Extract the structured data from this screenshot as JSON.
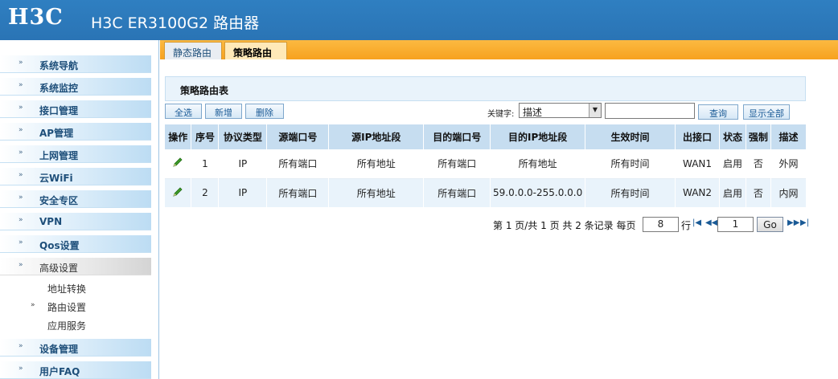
{
  "header": {
    "logo": "H3C",
    "product": "H3C ER3100G2 路由器"
  },
  "sidebar": {
    "items": [
      {
        "label": "系统导航"
      },
      {
        "label": "系统监控"
      },
      {
        "label": "接口管理"
      },
      {
        "label": "AP管理"
      },
      {
        "label": "上网管理"
      },
      {
        "label": "云WiFi"
      },
      {
        "label": "安全专区"
      },
      {
        "label": "VPN"
      },
      {
        "label": "Qos设置"
      },
      {
        "label": "高级设置"
      },
      {
        "label": "设备管理"
      },
      {
        "label": "用户FAQ"
      }
    ],
    "sub_items": [
      {
        "label": "地址转换"
      },
      {
        "label": "路由设置"
      },
      {
        "label": "应用服务"
      }
    ]
  },
  "tabs": [
    {
      "label": "静态路由"
    },
    {
      "label": "策略路由"
    }
  ],
  "panel": {
    "title": "策略路由表"
  },
  "toolbar": {
    "select_all": "全选",
    "add": "新增",
    "delete": "删除",
    "keyword_label": "关键字:",
    "keyword_select": "描述",
    "search_value": "",
    "query": "查询",
    "show_all": "显示全部"
  },
  "table": {
    "headers": [
      "操作",
      "序号",
      "协议类型",
      "源端口号",
      "源IP地址段",
      "目的端口号",
      "目的IP地址段",
      "生效时间",
      "出接口",
      "状态",
      "强制",
      "描述"
    ],
    "rows": [
      {
        "seq": "1",
        "protocol": "IP",
        "src_port": "所有端口",
        "src_ip": "所有地址",
        "dst_port": "所有端口",
        "dst_ip": "所有地址",
        "time": "所有时间",
        "iface": "WAN1",
        "status": "启用",
        "force": "否",
        "desc": "外网"
      },
      {
        "seq": "2",
        "protocol": "IP",
        "src_port": "所有端口",
        "src_ip": "所有地址",
        "dst_port": "所有端口",
        "dst_ip": "59.0.0.0-255.0.0.0",
        "time": "所有时间",
        "iface": "WAN2",
        "status": "启用",
        "force": "否",
        "desc": "内网"
      }
    ]
  },
  "pager": {
    "summary": "第 1 页/共 1 页 共 2 条记录 每页",
    "per_page": "8",
    "rows_suffix": "行",
    "page_input": "1",
    "go": "Go"
  },
  "colors": {
    "header_bg": "#2f7fc1",
    "tabbar_bg": "#f7a21f",
    "table_header_bg": "#c6ddf0",
    "row_alt_bg": "#e9f3fb",
    "edit_icon": "#2e8b1e"
  },
  "icons": {
    "edit": "pencil-icon",
    "menu_arrow": "double-chevron-icon"
  }
}
